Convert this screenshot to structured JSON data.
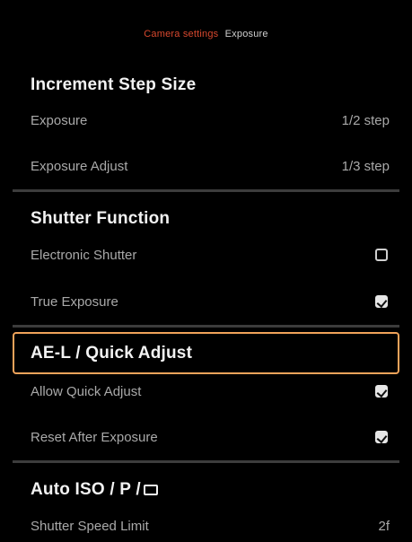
{
  "breadcrumb": {
    "parent": "Camera settings",
    "current": "Exposure"
  },
  "sections": {
    "increment": {
      "title": "Increment Step Size",
      "rows": [
        {
          "label": "Exposure",
          "value": "1/2 step"
        },
        {
          "label": "Exposure Adjust",
          "value": "1/3 step"
        }
      ]
    },
    "shutter": {
      "title": "Shutter Function",
      "rows": [
        {
          "label": "Electronic Shutter",
          "checked": false
        },
        {
          "label": "True Exposure",
          "checked": true
        }
      ]
    },
    "ael": {
      "title": "AE-L / Quick Adjust",
      "rows": [
        {
          "label": "Allow Quick Adjust",
          "checked": true
        },
        {
          "label": "Reset After Exposure",
          "checked": true
        }
      ]
    },
    "autoiso": {
      "title": "Auto ISO / P /",
      "rows": [
        {
          "label": "Shutter Speed Limit",
          "value": "2f"
        }
      ]
    }
  },
  "colors": {
    "accent": "#d8482e",
    "highlight": "#f0a35a",
    "background": "#000000"
  }
}
